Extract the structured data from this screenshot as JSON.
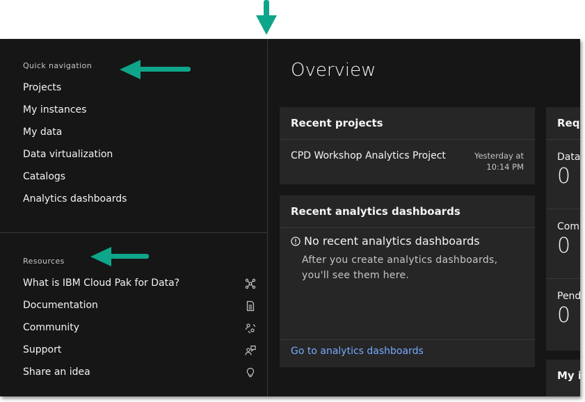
{
  "quick_nav": {
    "title": "Quick navigation",
    "items": [
      "Projects",
      "My instances",
      "My data",
      "Data virtualization",
      "Catalogs",
      "Analytics dashboards"
    ]
  },
  "resources": {
    "title": "Resources",
    "items": [
      {
        "label": "What is IBM Cloud Pak for Data?",
        "icon": "network-icon"
      },
      {
        "label": "Documentation",
        "icon": "document-icon"
      },
      {
        "label": "Community",
        "icon": "community-icon"
      },
      {
        "label": "Support",
        "icon": "support-icon"
      },
      {
        "label": "Share an idea",
        "icon": "lightbulb-icon"
      }
    ]
  },
  "overview": {
    "title": "Overview",
    "recent_projects": {
      "title": "Recent projects",
      "project_name": "CPD Workshop Analytics Project",
      "time_line1": "Yesterday at",
      "time_line2": "10:14 PM"
    },
    "recent_dashboards": {
      "title": "Recent analytics dashboards",
      "empty_title": "No recent analytics dashboards",
      "empty_body": "After you create analytics dashboards, you'll see them here.",
      "link": "Go to analytics dashboards"
    },
    "requests": {
      "title": "Req",
      "rows": [
        {
          "label": "Data",
          "value": "0"
        },
        {
          "label": "Com",
          "value": "0"
        },
        {
          "label": "Pend",
          "value": "0"
        }
      ]
    },
    "my_instances": {
      "title": "My i"
    }
  },
  "colors": {
    "annotation_arrow": "#0fa58a",
    "link": "#78a9ff",
    "background": "#161616",
    "card": "#262626"
  }
}
